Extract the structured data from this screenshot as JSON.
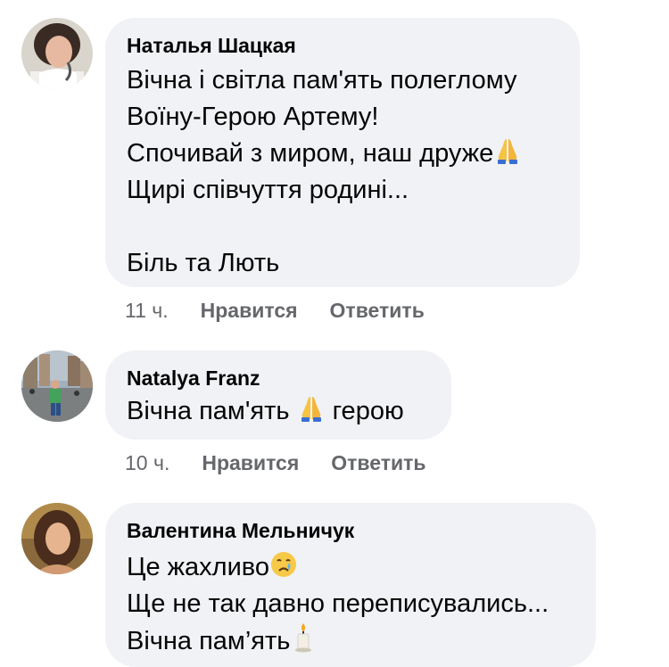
{
  "comments": [
    {
      "author": "Наталья Шацкая",
      "lines": [
        {
          "text": "Вічна і світла пам'ять полеглому"
        },
        {
          "text": "Воїну-Герою Артему!"
        },
        {
          "text": "Спочивай з миром, наш друже",
          "emoji": "folded-hands"
        },
        {
          "text": "Щирі співчуття родині..."
        },
        {
          "text": ""
        },
        {
          "text": "Біль та Лють"
        }
      ],
      "time": "11 ч.",
      "like_label": "Нравится",
      "reply_label": "Ответить"
    },
    {
      "author": "Natalya Franz",
      "lines": [
        {
          "text_before": "Вічна пам'ять ",
          "emoji": "folded-hands",
          "text_after": " герою"
        }
      ],
      "time": "10 ч.",
      "like_label": "Нравится",
      "reply_label": "Ответить"
    },
    {
      "author": "Валентина Мельничук",
      "lines": [
        {
          "text": "Це жахливо",
          "emoji": "crying-face"
        },
        {
          "text": "Ще не так давно переписувались..."
        },
        {
          "text": "Вічна пам’ять",
          "emoji": "candle"
        }
      ]
    }
  ],
  "colors": {
    "bubble_bg": "#f0f2f5",
    "text": "#050505",
    "secondary": "#65676b"
  }
}
